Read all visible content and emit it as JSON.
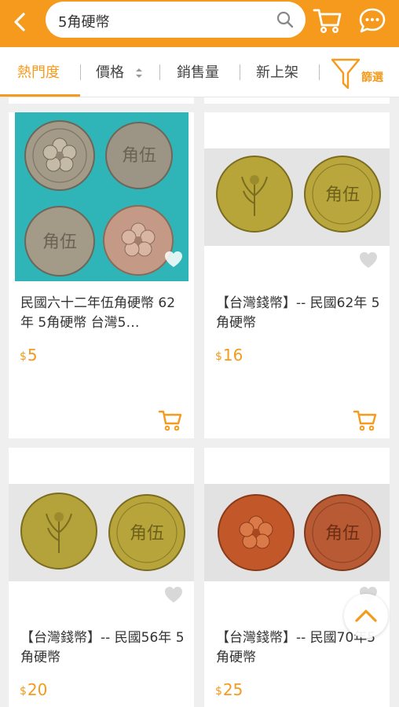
{
  "search": {
    "query": "5角硬幣"
  },
  "sort": {
    "popularity": "熱門度",
    "price": "價格",
    "sales": "銷售量",
    "newest": "新上架",
    "filter": "篩選"
  },
  "products": [
    {
      "title": "民國六十二年伍角硬幣 62年 5角硬幣 台灣5…",
      "currency": "$",
      "price": "5"
    },
    {
      "title": "【台灣錢幣】-- 民國62年 5角硬幣",
      "currency": "$",
      "price": "16"
    },
    {
      "title": "【台灣錢幣】-- 民國56年 5角硬幣",
      "currency": "$",
      "price": "20"
    },
    {
      "title": "【台灣錢幣】-- 民國70年5角硬幣",
      "currency": "$",
      "price": "25"
    }
  ],
  "colors": {
    "brand": "#f59a1c",
    "background": "#efefef",
    "card": "#ffffff"
  }
}
